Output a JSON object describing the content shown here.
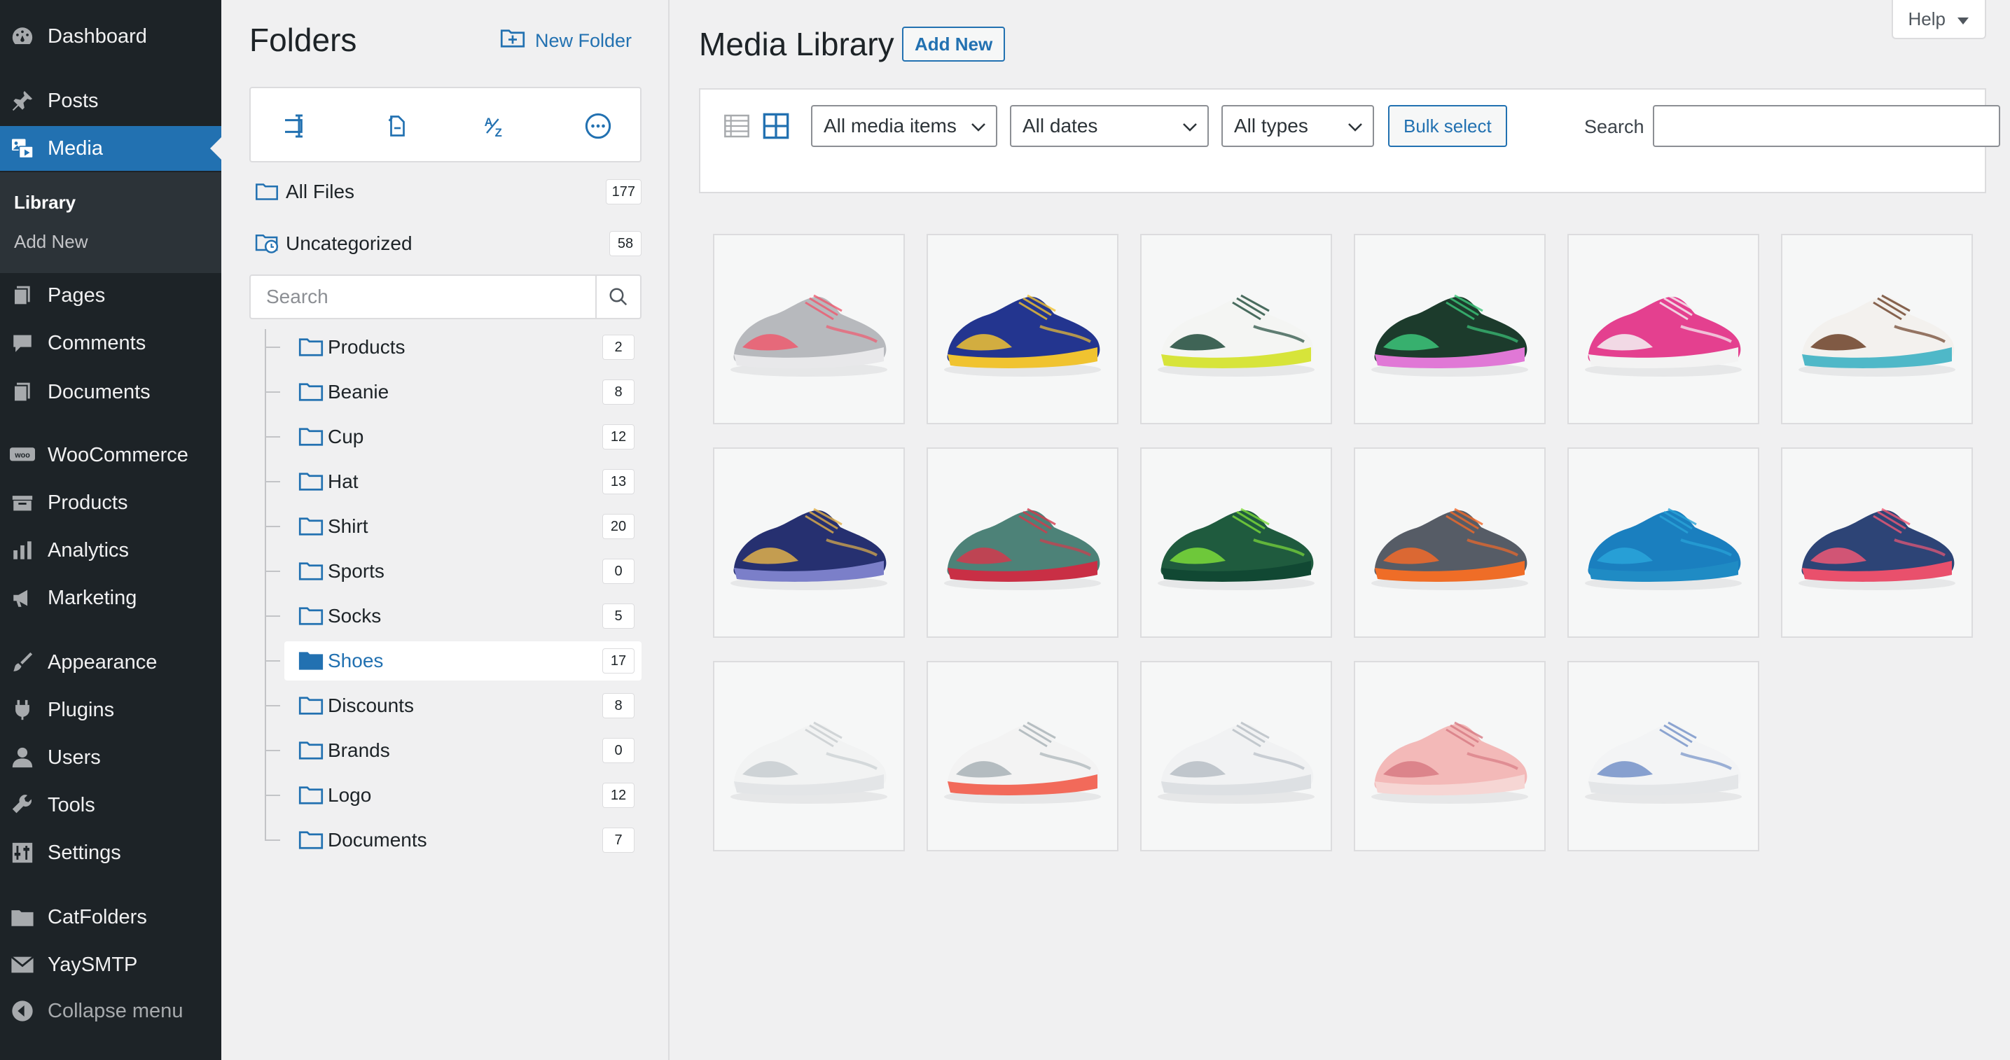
{
  "sidebar": {
    "items": [
      {
        "label": "Dashboard",
        "icon": "dashboard-icon"
      },
      {
        "label": "Posts",
        "icon": "pin-icon"
      },
      {
        "label": "Media",
        "icon": "media-icon"
      },
      {
        "label": "Pages",
        "icon": "pages-icon"
      },
      {
        "label": "Comments",
        "icon": "comments-icon"
      },
      {
        "label": "Documents",
        "icon": "documents-icon"
      },
      {
        "label": "WooCommerce",
        "icon": "woo-icon"
      },
      {
        "label": "Products",
        "icon": "products-icon"
      },
      {
        "label": "Analytics",
        "icon": "analytics-icon"
      },
      {
        "label": "Marketing",
        "icon": "megaphone-icon"
      },
      {
        "label": "Appearance",
        "icon": "brush-icon"
      },
      {
        "label": "Plugins",
        "icon": "plug-icon"
      },
      {
        "label": "Users",
        "icon": "user-icon"
      },
      {
        "label": "Tools",
        "icon": "wrench-icon"
      },
      {
        "label": "Settings",
        "icon": "settings-icon"
      },
      {
        "label": "CatFolders",
        "icon": "folder-icon"
      },
      {
        "label": "YaySMTP",
        "icon": "mail-icon"
      }
    ],
    "submenu": [
      "Library",
      "Add New"
    ],
    "collapse_label": "Collapse menu"
  },
  "folders": {
    "title": "Folders",
    "new_folder_label": "New Folder",
    "all_files": {
      "label": "All Files",
      "count": "177"
    },
    "uncategorized": {
      "label": "Uncategorized",
      "count": "58"
    },
    "search_placeholder": "Search",
    "items": [
      {
        "label": "Products",
        "count": "2"
      },
      {
        "label": "Beanie",
        "count": "8"
      },
      {
        "label": "Cup",
        "count": "12"
      },
      {
        "label": "Hat",
        "count": "13"
      },
      {
        "label": "Shirt",
        "count": "20"
      },
      {
        "label": "Sports",
        "count": "0"
      },
      {
        "label": "Socks",
        "count": "5"
      },
      {
        "label": "Shoes",
        "count": "17"
      },
      {
        "label": "Discounts",
        "count": "8"
      },
      {
        "label": "Brands",
        "count": "0"
      },
      {
        "label": "Logo",
        "count": "12"
      },
      {
        "label": "Documents",
        "count": "7"
      }
    ],
    "active": "Shoes"
  },
  "main": {
    "title": "Media Library",
    "add_new_label": "Add New",
    "help_label": "Help",
    "filters": {
      "media_items": "All media items",
      "dates": "All dates",
      "types": "All types",
      "bulk_select": "Bulk select",
      "search_label": "Search",
      "search_value": ""
    }
  },
  "colors": {
    "sidebar_bg": "#1d2327",
    "accent": "#2271b1",
    "page_bg": "#f0f0f1"
  },
  "thumbnails": [
    {
      "name": "shoe-grey-pink",
      "upper": "#b7b9bd",
      "accent": "#ef5a6f",
      "sole": "#e8e8ea"
    },
    {
      "name": "shoe-navy-yellow",
      "upper": "#23358f",
      "accent": "#f1c232",
      "sole": "#f0c330"
    },
    {
      "name": "shoe-white-lime",
      "upper": "#f4f5f3",
      "accent": "#1f4a3a",
      "sole": "#d7e43a"
    },
    {
      "name": "shoe-darkgreen-pink",
      "upper": "#1c3b2c",
      "accent": "#3cc67a",
      "sole": "#e078d6"
    },
    {
      "name": "shoe-pink-white",
      "upper": "#e4408f",
      "accent": "#f5f5f5",
      "sole": "#f3f3f3"
    },
    {
      "name": "shoe-white-brown",
      "upper": "#f3f1ee",
      "accent": "#6b3f26",
      "sole": "#4fb8c8"
    },
    {
      "name": "shoe-navy-mustard",
      "upper": "#263070",
      "accent": "#e1b04a",
      "sole": "#7b7fc9"
    },
    {
      "name": "shoe-teal-red",
      "upper": "#4d8278",
      "accent": "#d23a4c",
      "sole": "#c92f45"
    },
    {
      "name": "shoe-lime-forest",
      "upper": "#1f5b3e",
      "accent": "#7ddc3a",
      "sole": "#114833"
    },
    {
      "name": "shoe-grey-orange",
      "upper": "#565c66",
      "accent": "#f26a2a",
      "sole": "#ef6d27"
    },
    {
      "name": "shoe-blue",
      "upper": "#1a7fbf",
      "accent": "#2aa4d9",
      "sole": "#1f8bc4"
    },
    {
      "name": "shoe-navy-coral",
      "upper": "#2d4476",
      "accent": "#ef5875",
      "sole": "#e9506c"
    },
    {
      "name": "shoe-white-grey",
      "upper": "#f2f3f3",
      "accent": "#c8cdd0",
      "sole": "#e3e5e7"
    },
    {
      "name": "shoe-white-coral",
      "upper": "#f3f3f3",
      "accent": "#a8b2b6",
      "sole": "#f26a5a"
    },
    {
      "name": "shoe-white-silver",
      "upper": "#f1f2f3",
      "accent": "#b7bec4",
      "sole": "#dde0e3"
    },
    {
      "name": "shoe-light-pink",
      "upper": "#f3b9b8",
      "accent": "#d77a83",
      "sole": "#f6d6d4"
    },
    {
      "name": "shoe-white-blue",
      "upper": "#f3f4f5",
      "accent": "#7391c8",
      "sole": "#e4e6e8"
    }
  ]
}
